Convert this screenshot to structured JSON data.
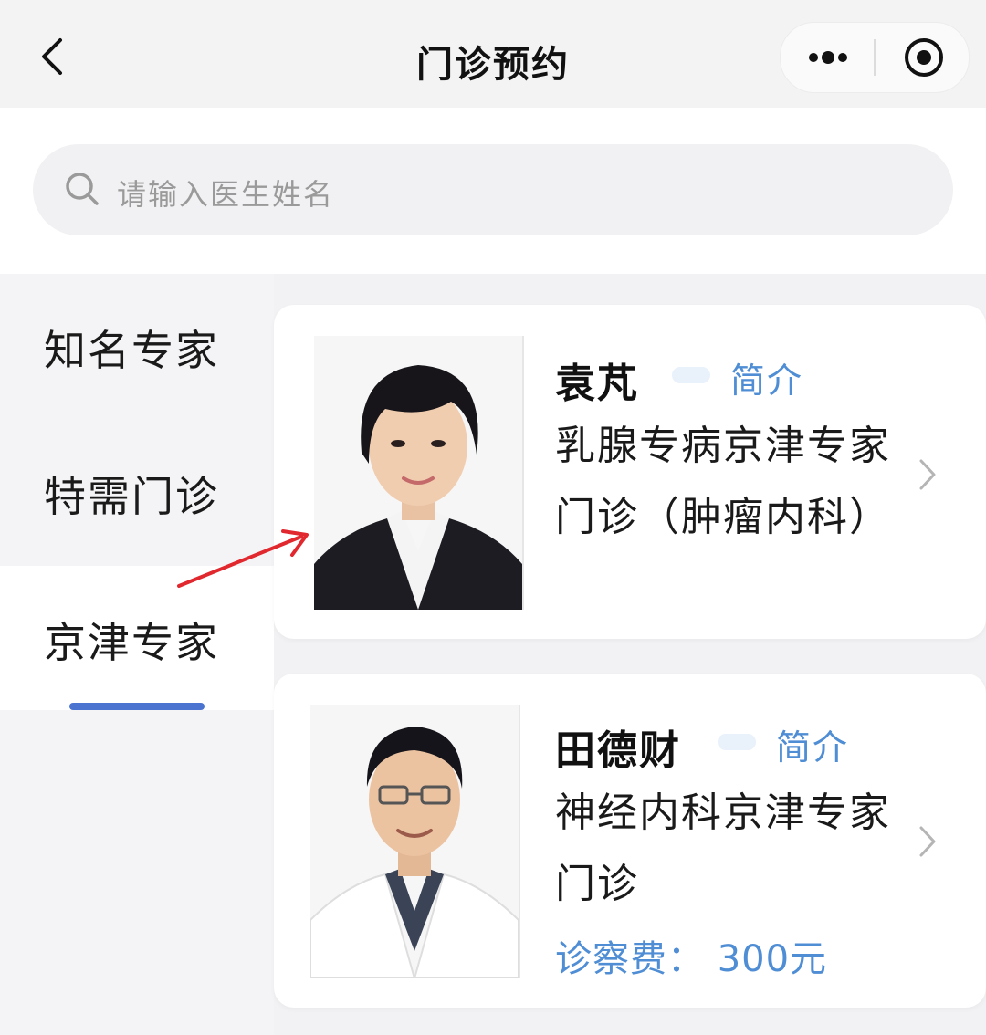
{
  "header": {
    "title": "门诊预约",
    "back_icon": "chevron-left-icon",
    "more_icon": "more-dots-icon",
    "target_icon": "target-icon"
  },
  "search": {
    "placeholder": "请输入医生姓名",
    "icon": "search-icon"
  },
  "sidebar": {
    "items": [
      {
        "label": "知名专家",
        "active": false
      },
      {
        "label": "特需门诊",
        "active": false
      },
      {
        "label": "京津专家",
        "active": true
      }
    ],
    "accent_color": "#4a74d0"
  },
  "doctors": [
    {
      "name": "袁芃",
      "intro_label": "简介",
      "department": "乳腺专病京津专家门诊（肿瘤内科）"
    },
    {
      "name": "田德财",
      "intro_label": "简介",
      "department": "神经内科京津专家门诊",
      "fee": "诊察费： 300元"
    }
  ],
  "colors": {
    "link": "#4f8dd4",
    "annotation_arrow": "#e0282e"
  }
}
